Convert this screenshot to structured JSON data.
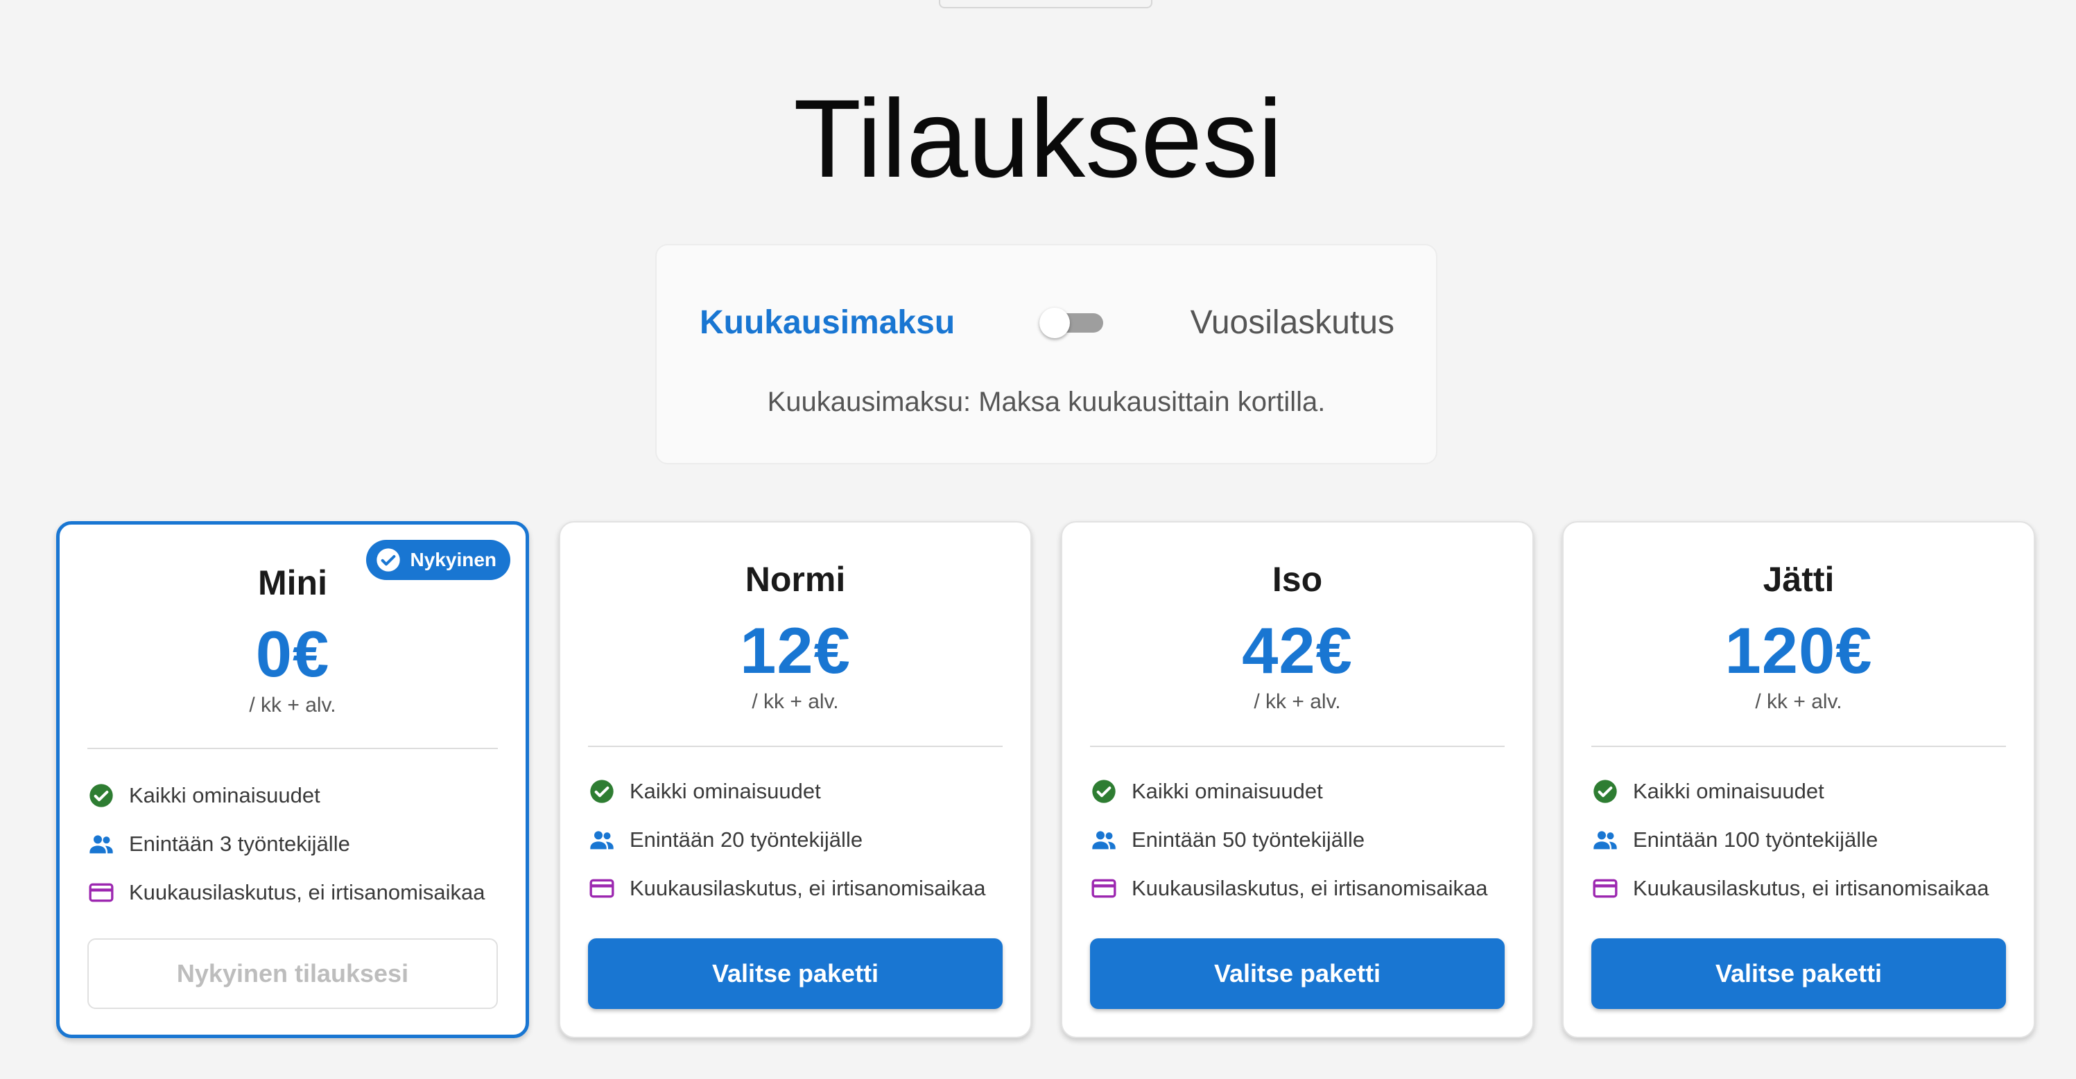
{
  "page": {
    "title": "Tilauksesi"
  },
  "billing": {
    "monthly_label": "Kuukausimaksu",
    "yearly_label": "Vuosilaskutus",
    "description": "Kuukausimaksu: Maksa kuukausittain kortilla.",
    "yearly_selected": false
  },
  "colors": {
    "accent": "#1976d2",
    "check_green": "#2e7d32",
    "card_purple": "#9c27b0",
    "background": "#f4f4f4"
  },
  "plans": [
    {
      "name": "Mini",
      "price": "0€",
      "period": "/ kk + alv.",
      "current": true,
      "badge": "Nykyinen",
      "features": [
        {
          "icon": "check-circle-icon",
          "text": "Kaikki ominaisuudet"
        },
        {
          "icon": "people-icon",
          "text": "Enintään 3 työntekijälle"
        },
        {
          "icon": "credit-card-icon",
          "text": "Kuukausilaskutus, ei irtisanomisaikaa"
        }
      ],
      "button_label": "Nykyinen tilauksesi"
    },
    {
      "name": "Normi",
      "price": "12€",
      "period": "/ kk + alv.",
      "current": false,
      "features": [
        {
          "icon": "check-circle-icon",
          "text": "Kaikki ominaisuudet"
        },
        {
          "icon": "people-icon",
          "text": "Enintään 20 työntekijälle"
        },
        {
          "icon": "credit-card-icon",
          "text": "Kuukausilaskutus, ei irtisanomisaikaa"
        }
      ],
      "button_label": "Valitse paketti"
    },
    {
      "name": "Iso",
      "price": "42€",
      "period": "/ kk + alv.",
      "current": false,
      "features": [
        {
          "icon": "check-circle-icon",
          "text": "Kaikki ominaisuudet"
        },
        {
          "icon": "people-icon",
          "text": "Enintään 50 työntekijälle"
        },
        {
          "icon": "credit-card-icon",
          "text": "Kuukausilaskutus, ei irtisanomisaikaa"
        }
      ],
      "button_label": "Valitse paketti"
    },
    {
      "name": "Jätti",
      "price": "120€",
      "period": "/ kk + alv.",
      "current": false,
      "features": [
        {
          "icon": "check-circle-icon",
          "text": "Kaikki ominaisuudet"
        },
        {
          "icon": "people-icon",
          "text": "Enintään 100 työntekijälle"
        },
        {
          "icon": "credit-card-icon",
          "text": "Kuukausilaskutus, ei irtisanomisaikaa"
        }
      ],
      "button_label": "Valitse paketti"
    }
  ]
}
